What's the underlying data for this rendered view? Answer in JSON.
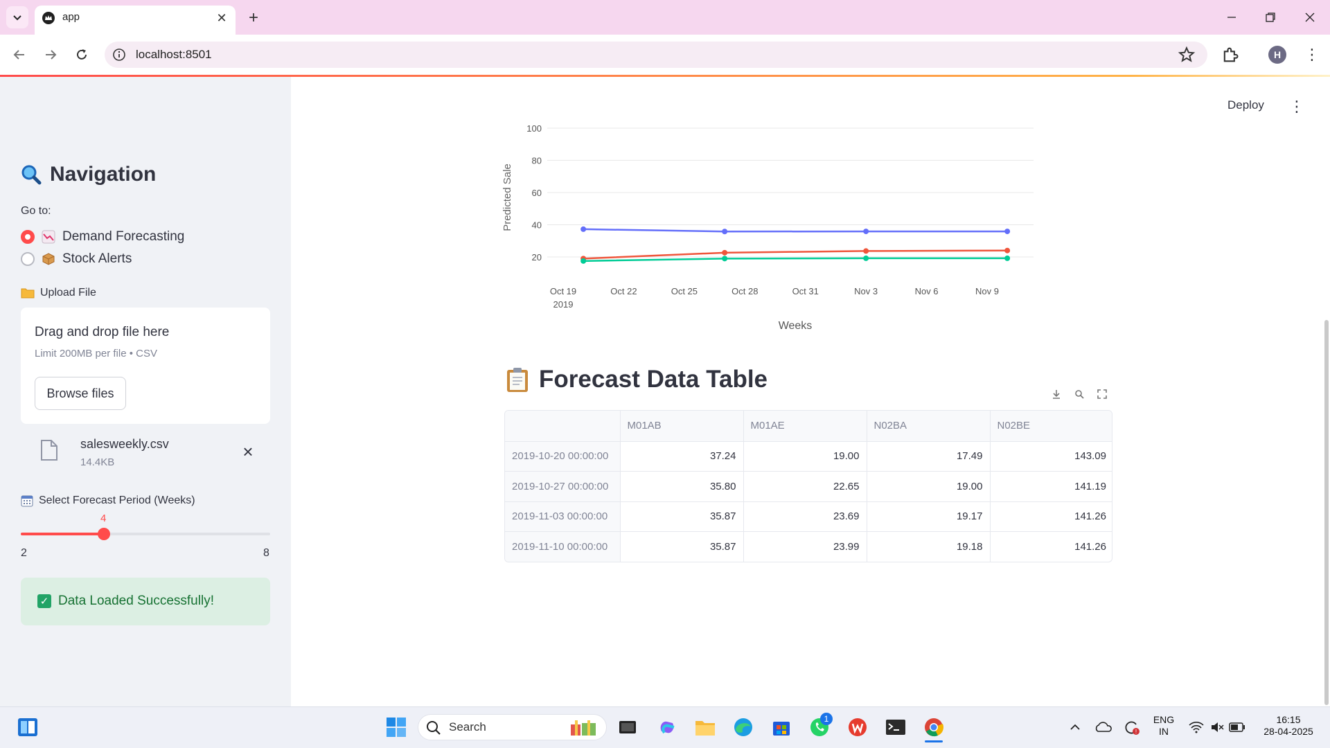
{
  "browser": {
    "tab_title": "app",
    "url": "localhost:8501",
    "profile_initial": "H"
  },
  "sidebar": {
    "title": "Navigation",
    "goto_label": "Go to:",
    "options": [
      {
        "label": "Demand Forecasting",
        "selected": true
      },
      {
        "label": "Stock Alerts",
        "selected": false
      }
    ],
    "upload_label": "Upload File",
    "dropzone_title": "Drag and drop file here",
    "dropzone_limit": "Limit 200MB per file • CSV",
    "browse_label": "Browse files",
    "file_name": "salesweekly.csv",
    "file_size": "14.4KB",
    "period_label": "Select Forecast Period (Weeks)",
    "slider": {
      "value": "4",
      "min": "2",
      "max": "8",
      "fraction": 0.333
    },
    "success_message": "Data Loaded Successfully!"
  },
  "header": {
    "deploy_label": "Deploy"
  },
  "chart_data": {
    "type": "line",
    "title": "",
    "xlabel": "Weeks",
    "ylabel": "Predicted Sale",
    "ylim": [
      0,
      100
    ],
    "y_ticks": [
      "20",
      "40",
      "60",
      "80",
      "100"
    ],
    "x_ticks": [
      "Oct 19",
      "Oct 22",
      "Oct 25",
      "Oct 28",
      "Oct 31",
      "Nov 3",
      "Nov 6",
      "Nov 9"
    ],
    "x_tick_sub": "2019",
    "x": [
      "2019-10-20",
      "2019-10-27",
      "2019-11-03",
      "2019-11-10"
    ],
    "series": [
      {
        "values": [
          37.24,
          35.8,
          35.87,
          35.87
        ],
        "color": "#636efa"
      },
      {
        "values": [
          19.0,
          22.65,
          23.69,
          23.99
        ],
        "color": "#ef553b"
      },
      {
        "values": [
          17.49,
          19.0,
          19.17,
          19.18
        ],
        "color": "#00cc96"
      }
    ]
  },
  "table": {
    "title": "Forecast Data Table",
    "columns": [
      "",
      "M01AB",
      "M01AE",
      "N02BA",
      "N02BE"
    ],
    "rows": [
      [
        "2019-10-20 00:00:00",
        "37.24",
        "19.00",
        "17.49",
        "143.09"
      ],
      [
        "2019-10-27 00:00:00",
        "35.80",
        "22.65",
        "19.00",
        "141.19"
      ],
      [
        "2019-11-03 00:00:00",
        "35.87",
        "23.69",
        "19.17",
        "141.26"
      ],
      [
        "2019-11-10 00:00:00",
        "35.87",
        "23.99",
        "19.18",
        "141.26"
      ]
    ]
  },
  "taskbar": {
    "search_placeholder": "Search",
    "whatsapp_badge": "1",
    "language": "ENG",
    "region": "IN",
    "time": "16:15",
    "date": "28-04-2025"
  }
}
